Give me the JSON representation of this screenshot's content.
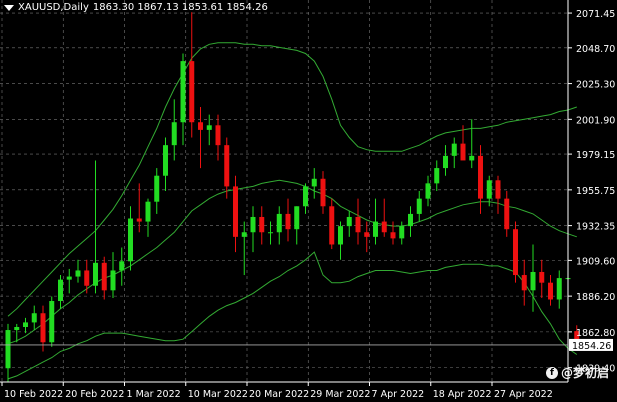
{
  "header": {
    "symbol": "XAUUSD,Daily",
    "ohlc": "1863.30 1867.13 1853.61 1854.26"
  },
  "watermark": {
    "icon": "facebook-icon",
    "text": "@梦初启"
  },
  "colors": {
    "background": "#000000",
    "bull": "#22dd22",
    "bear": "#ee1111",
    "bands": "#33aa33",
    "grid": "#777777",
    "current_price_bg": "#ffffff"
  },
  "chart_data": {
    "type": "candlestick",
    "symbol": "XAUUSD",
    "timeframe": "Daily",
    "ylim": [
      1830,
      2080
    ],
    "yticks": [
      1839.4,
      1862.8,
      1886.2,
      1909.6,
      1932.35,
      1955.75,
      1979.15,
      2001.9,
      2025.3,
      2048.7,
      2071.45
    ],
    "ytick_labels": [
      "1839.40",
      "1862.80",
      "1886.20",
      "1909.60",
      "1932.35",
      "1955.75",
      "1979.15",
      "2001.90",
      "2025.30",
      "2048.70",
      "2071.45"
    ],
    "xtick_labels": [
      {
        "index": 0,
        "label": "10 Feb 2022"
      },
      {
        "index": 7,
        "label": "20 Feb 2022"
      },
      {
        "index": 14,
        "label": "1 Mar 2022"
      },
      {
        "index": 21,
        "label": "10 Mar 2022"
      },
      {
        "index": 28,
        "label": "20 Mar 2022"
      },
      {
        "index": 35,
        "label": "29 Mar 2022"
      },
      {
        "index": 42,
        "label": "7 Apr 2022"
      },
      {
        "index": 49,
        "label": "18 Apr 2022"
      },
      {
        "index": 56,
        "label": "27 Apr 2022"
      }
    ],
    "current_price": 1854.26,
    "candles": [
      [
        1839,
        1868,
        1830,
        1864
      ],
      [
        1864,
        1868,
        1856,
        1866
      ],
      [
        1866,
        1872,
        1862,
        1869
      ],
      [
        1869,
        1880,
        1864,
        1875
      ],
      [
        1875,
        1880,
        1850,
        1856
      ],
      [
        1856,
        1886,
        1853,
        1883
      ],
      [
        1883,
        1900,
        1878,
        1897
      ],
      [
        1897,
        1904,
        1888,
        1899
      ],
      [
        1899,
        1910,
        1895,
        1903
      ],
      [
        1903,
        1910,
        1888,
        1893
      ],
      [
        1893,
        1975,
        1888,
        1908
      ],
      [
        1908,
        1912,
        1884,
        1890
      ],
      [
        1890,
        1915,
        1885,
        1903
      ],
      [
        1903,
        1918,
        1893,
        1909
      ],
      [
        1909,
        1945,
        1903,
        1937
      ],
      [
        1937,
        1960,
        1928,
        1935
      ],
      [
        1935,
        1950,
        1925,
        1948
      ],
      [
        1948,
        1970,
        1940,
        1965
      ],
      [
        1965,
        1990,
        1955,
        1985
      ],
      [
        1985,
        2015,
        1975,
        2000
      ],
      [
        2000,
        2045,
        1985,
        2040
      ],
      [
        2040,
        2072,
        1990,
        2000
      ],
      [
        2000,
        2010,
        1970,
        1995
      ],
      [
        1995,
        2005,
        1985,
        1998
      ],
      [
        1998,
        2005,
        1975,
        1985
      ],
      [
        1985,
        1990,
        1950,
        1958
      ],
      [
        1958,
        1965,
        1915,
        1925
      ],
      [
        1925,
        1935,
        1900,
        1928
      ],
      [
        1928,
        1945,
        1915,
        1938
      ],
      [
        1938,
        1945,
        1920,
        1928
      ],
      [
        1928,
        1935,
        1920,
        1928
      ],
      [
        1928,
        1945,
        1920,
        1940
      ],
      [
        1940,
        1950,
        1922,
        1930
      ],
      [
        1930,
        1945,
        1920,
        1945
      ],
      [
        1945,
        1960,
        1940,
        1958
      ],
      [
        1958,
        1970,
        1950,
        1963
      ],
      [
        1963,
        1968,
        1940,
        1945
      ],
      [
        1945,
        1950,
        1917,
        1920
      ],
      [
        1920,
        1935,
        1910,
        1932
      ],
      [
        1932,
        1942,
        1925,
        1938
      ],
      [
        1938,
        1950,
        1920,
        1928
      ],
      [
        1928,
        1935,
        1915,
        1925
      ],
      [
        1925,
        1950,
        1920,
        1935
      ],
      [
        1935,
        1950,
        1925,
        1928
      ],
      [
        1928,
        1935,
        1920,
        1924
      ],
      [
        1924,
        1935,
        1920,
        1932
      ],
      [
        1932,
        1945,
        1925,
        1940
      ],
      [
        1940,
        1955,
        1935,
        1950
      ],
      [
        1950,
        1965,
        1945,
        1960
      ],
      [
        1960,
        1975,
        1955,
        1970
      ],
      [
        1970,
        1985,
        1965,
        1978
      ],
      [
        1978,
        1990,
        1970,
        1986
      ],
      [
        1986,
        1998,
        1980,
        1975
      ],
      [
        1975,
        2002,
        1970,
        1978
      ],
      [
        1978,
        1985,
        1940,
        1950
      ],
      [
        1950,
        1965,
        1945,
        1962
      ],
      [
        1962,
        1965,
        1940,
        1950
      ],
      [
        1950,
        1955,
        1925,
        1930
      ],
      [
        1930,
        1935,
        1895,
        1900
      ],
      [
        1900,
        1910,
        1880,
        1890
      ],
      [
        1890,
        1920,
        1876,
        1902
      ],
      [
        1902,
        1910,
        1885,
        1895
      ],
      [
        1895,
        1900,
        1880,
        1884
      ],
      [
        1884,
        1903,
        1878,
        1898
      ],
      [
        1898,
        1903,
        1880,
        1898
      ],
      [
        1863.3,
        1867.13,
        1853.61,
        1854.26
      ]
    ],
    "bands_mid": [
      1855,
      1857,
      1860,
      1864,
      1868,
      1873,
      1878,
      1882,
      1887,
      1891,
      1895,
      1898,
      1900,
      1903,
      1906,
      1910,
      1914,
      1918,
      1923,
      1928,
      1935,
      1942,
      1946,
      1950,
      1953,
      1955,
      1956,
      1957,
      1958,
      1960,
      1961,
      1962,
      1961,
      1960,
      1958,
      1955,
      1953,
      1950,
      1945,
      1942,
      1939,
      1936,
      1934,
      1933,
      1932,
      1932,
      1933,
      1935,
      1937,
      1940,
      1942,
      1944,
      1946,
      1947,
      1948,
      1948,
      1947,
      1945,
      1944,
      1942,
      1940,
      1936,
      1932,
      1929,
      1927,
      1925
    ],
    "bands_upper": [
      1873,
      1878,
      1884,
      1890,
      1896,
      1902,
      1908,
      1914,
      1919,
      1924,
      1929,
      1936,
      1943,
      1952,
      1962,
      1972,
      1984,
      1996,
      2010,
      2022,
      2032,
      2042,
      2048,
      2051,
      2052,
      2052,
      2052,
      2051,
      2051,
      2050,
      2050,
      2049,
      2048,
      2047,
      2045,
      2040,
      2030,
      2015,
      1998,
      1990,
      1984,
      1982,
      1981,
      1981,
      1981,
      1981,
      1983,
      1985,
      1988,
      1991,
      1993,
      1994,
      1995,
      1996,
      1996,
      1997,
      1998,
      2000,
      2001,
      2002,
      2003,
      2004,
      2005,
      2007,
      2008,
      2010
    ],
    "bands_lower": [
      1832,
      1834,
      1837,
      1840,
      1843,
      1846,
      1850,
      1852,
      1855,
      1857,
      1860,
      1862,
      1862,
      1862,
      1861,
      1860,
      1859,
      1858,
      1857,
      1857,
      1858,
      1863,
      1868,
      1873,
      1877,
      1880,
      1882,
      1885,
      1888,
      1892,
      1896,
      1899,
      1903,
      1906,
      1910,
      1915,
      1900,
      1895,
      1895,
      1896,
      1899,
      1901,
      1903,
      1903,
      1903,
      1902,
      1901,
      1902,
      1903,
      1903,
      1905,
      1906,
      1907,
      1907,
      1907,
      1906,
      1906,
      1904,
      1902,
      1895,
      1886,
      1876,
      1868,
      1858,
      1852,
      1848
    ]
  }
}
